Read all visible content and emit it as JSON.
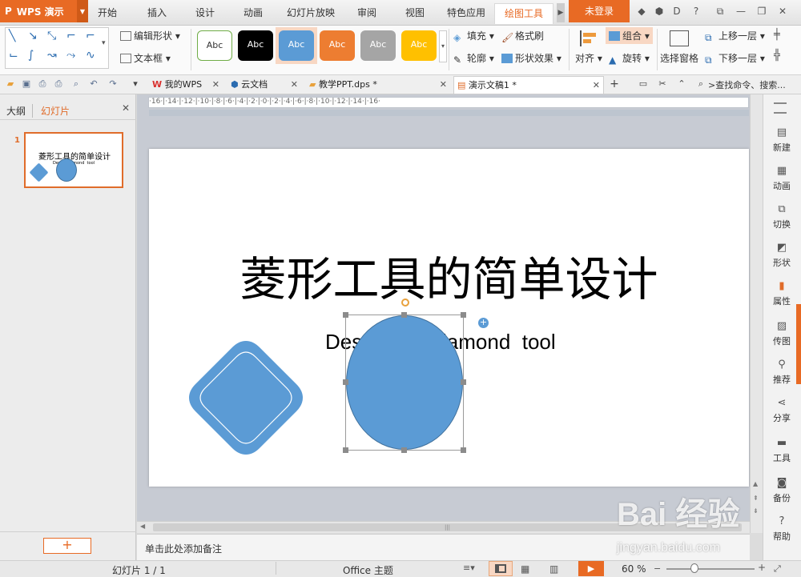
{
  "app": {
    "brand_logo": "P",
    "brand_name": "WPS 演示",
    "login_label": "未登录"
  },
  "menu": {
    "tabs": [
      "开始",
      "插入",
      "设计",
      "动画",
      "幻灯片放映",
      "审阅",
      "视图",
      "特色应用",
      "绘图工具"
    ],
    "active": "绘图工具"
  },
  "ribbon": {
    "edit_shape": "编辑形状",
    "text_box": "文本框",
    "style_sample": "Abc",
    "style_colors": [
      "#ffffff",
      "#000000",
      "#5b9bd5",
      "#ed7d31",
      "#a5a5a5",
      "#ffc000"
    ],
    "fill": "填充",
    "outline": "轮廓",
    "format_painter": "格式刷",
    "shape_effect": "形状效果",
    "align": "对齐",
    "group": "组合",
    "rotate": "旋转",
    "selection_pane": "选择窗格",
    "bring_forward": "上移一层",
    "send_backward": "下移一层"
  },
  "doc_tabs": [
    {
      "label": "我的WPS",
      "icon": "wps-icon"
    },
    {
      "label": "云文档",
      "icon": "cloud-doc-icon"
    },
    {
      "label": "教学PPT.dps *",
      "icon": "folder-icon"
    },
    {
      "label": "演示文稿1 *",
      "icon": "ppt-file-icon",
      "active": true
    }
  ],
  "search": {
    "placeholder": ">查找命令、搜索..."
  },
  "left_panel": {
    "tab_outline": "大纲",
    "tab_slides": "幻灯片",
    "slide_number": "1",
    "thumb_title": "菱形工具的简单设计",
    "thumb_subtitle": "Des       iamond  tool",
    "add_button": "+"
  },
  "slide": {
    "title": "菱形工具的简单设计",
    "subtitle": "Design diamond  tool",
    "subtitle_visible_left": "Des",
    "subtitle_visible_right": "iamond  tool",
    "shape_color": "#5b9bd5",
    "shape_border": "#41719c"
  },
  "ruler_text": "·16·|·14·|·12·|·10·|·8·|·6·|·4·|·2·|·0·|·2·|·4·|·6·|·8·|·10·|·12·|·14·|·16·",
  "notes_placeholder": "单击此处添加备注",
  "right_sidebar": [
    {
      "label": "新建",
      "icon": "new-icon"
    },
    {
      "label": "动画",
      "icon": "animation-icon"
    },
    {
      "label": "切换",
      "icon": "transition-icon"
    },
    {
      "label": "形状",
      "icon": "shape-icon"
    },
    {
      "label": "属性",
      "icon": "property-icon"
    },
    {
      "label": "传图",
      "icon": "image-upload-icon"
    },
    {
      "label": "推荐",
      "icon": "recommend-icon"
    },
    {
      "label": "分享",
      "icon": "share-icon"
    },
    {
      "label": "工具",
      "icon": "tools-icon"
    },
    {
      "label": "备份",
      "icon": "backup-icon"
    },
    {
      "label": "帮助",
      "icon": "help-icon"
    }
  ],
  "status": {
    "slide_counter": "幻灯片 1 / 1",
    "theme": "Office 主题",
    "zoom": "60 %"
  },
  "watermark": {
    "line1": "Bai 经验",
    "line2": "jingyan.baidu.com"
  }
}
